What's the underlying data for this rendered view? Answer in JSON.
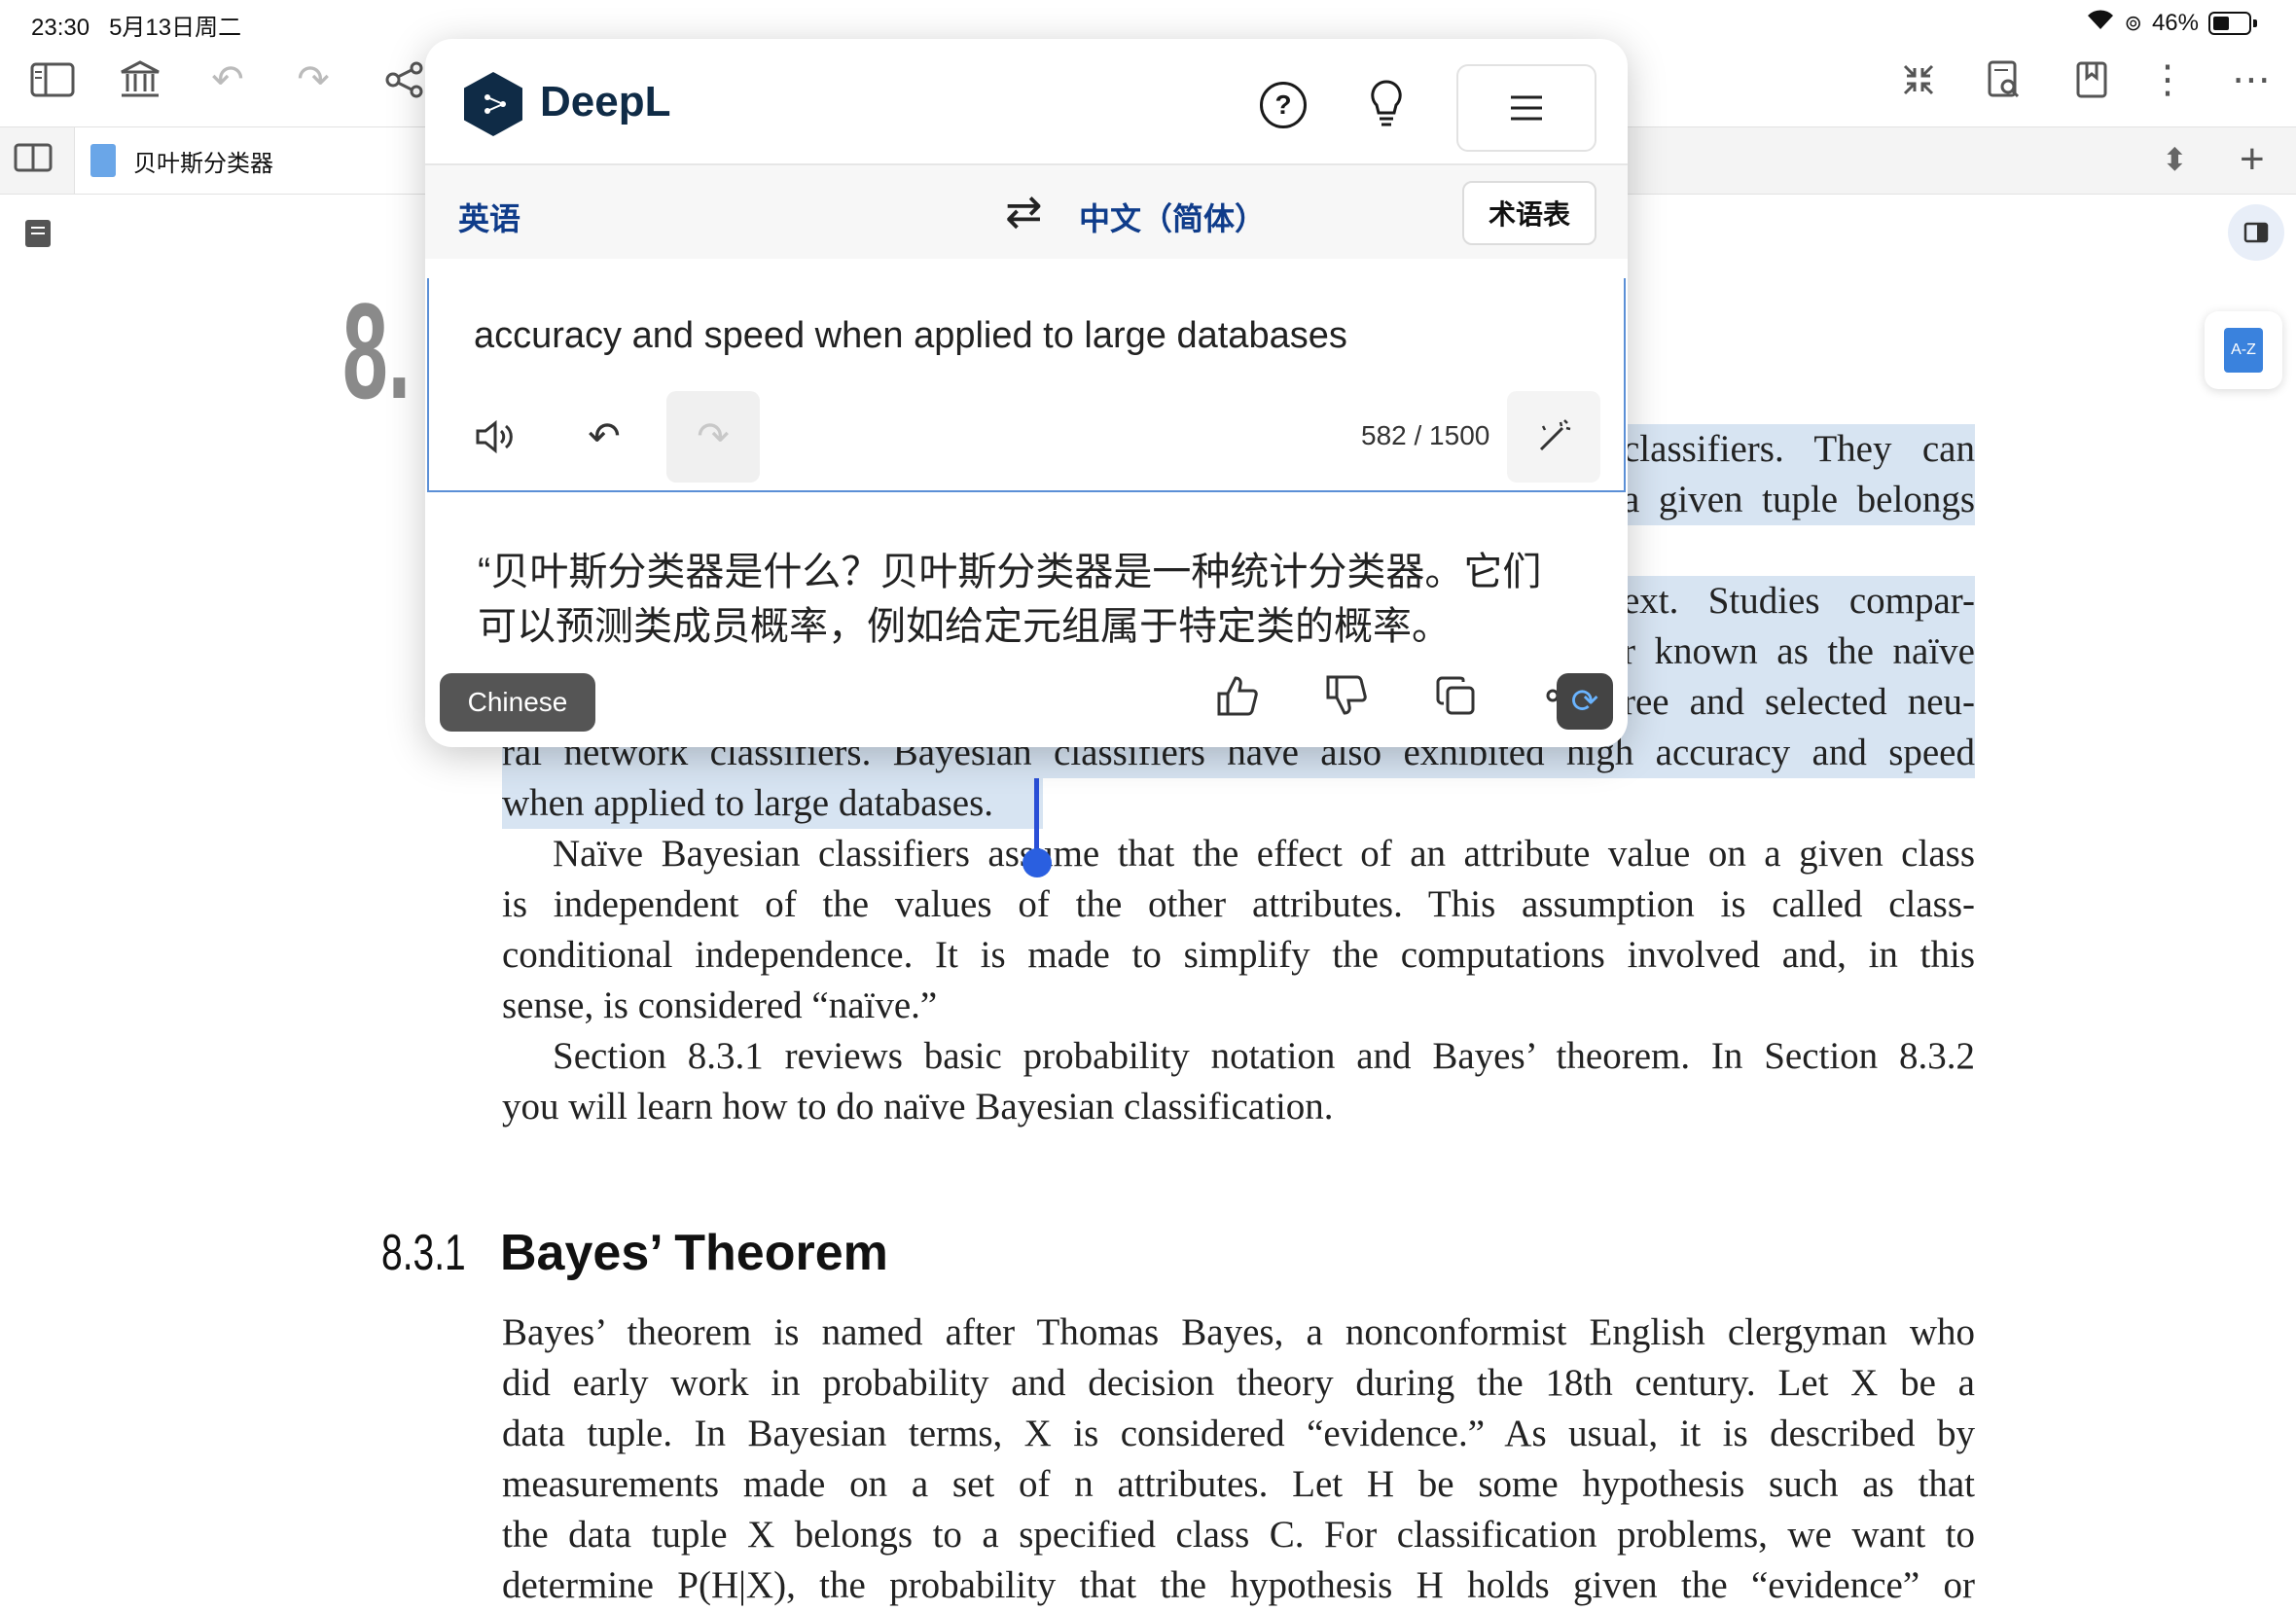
{
  "status": {
    "time": "23:30",
    "date": "5月13日周二",
    "battery": "46%"
  },
  "toolbar": {
    "left_icons": [
      "sidebar-icon",
      "library-icon",
      "undo-icon",
      "redo-icon",
      "share-icon"
    ],
    "right_icons": [
      "collapse-icon",
      "search-doc-icon",
      "bookmark-icon",
      "more-vertical-icon",
      "more-horizontal-icon"
    ]
  },
  "tabs": [
    {
      "label": "贝叶斯分类器"
    }
  ],
  "deepl": {
    "brand": "DeepL",
    "source_lang": "英语",
    "target_lang": "中文（简体）",
    "glossary_label": "术语表",
    "source_text": "accuracy and speed when applied to large databases",
    "char_count": "582 / 1500",
    "target_text_line1": "“贝叶斯分类器是什么？贝叶斯分类器是一种统计分类器。它们",
    "target_text_line2": "可以预测类成员概率，例如给定元组属于特定类的概率。",
    "chip_label": "Chinese",
    "accent": "#0f2b46"
  },
  "book": {
    "chapter_number": "8.",
    "highlighted_lines": [
      {
        "text": "classifiers. They can"
      },
      {
        "text": "a given tuple belongs"
      },
      {
        "text": "ext. Studies compar-"
      },
      {
        "text": "r known as the naïve"
      },
      {
        "text": "ree and selected neu-"
      },
      {
        "text": "ral network classifiers. Bayesian classifiers have also exhibited high accuracy and speed"
      },
      {
        "text": "when applied to large databases."
      }
    ],
    "paragraph1": [
      "Naïve Bayesian classifiers assume that the effect of an attribute value on a given class",
      "is independent of the values of the other attributes. This assumption is called class-",
      "conditional independence. It is made to simplify the computations involved and, in this",
      "sense, is considered “naïve.”"
    ],
    "paragraph2": [
      "Section 8.3.1 reviews basic probability notation and Bayes’ theorem. In Section 8.3.2",
      "you will learn how to do naïve Bayesian classification."
    ],
    "section_number": "8.3.1",
    "section_title": "Bayes’ Theorem",
    "paragraph3": [
      "Bayes’ theorem is named after Thomas Bayes, a nonconformist English clergyman who",
      "did early work in probability and decision theory during the 18th century. Let X be a",
      "data tuple. In Bayesian terms, X is considered “evidence.” As usual, it is described by",
      "measurements made on a set of n attributes. Let H be some hypothesis such as that",
      "the data tuple X belongs to a specified class C. For classification problems, we want to",
      "determine P(H|X), the probability that the hypothesis H holds given the “evidence” or"
    ]
  }
}
